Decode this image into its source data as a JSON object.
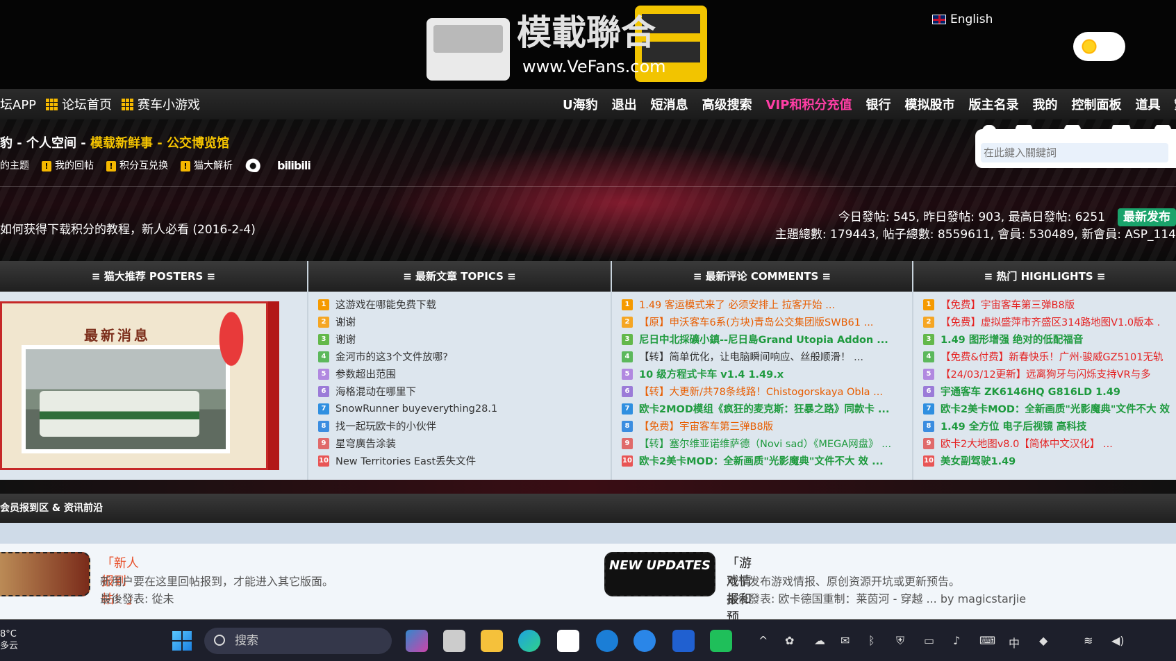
{
  "header": {
    "logo_text": "模載聯合",
    "logo_url": "www.VeFans.com",
    "language": "English"
  },
  "nav": {
    "left": [
      "坛APP",
      "论坛首页",
      "赛车小游戏"
    ],
    "right": [
      "U海豹",
      "退出",
      "短消息",
      "高级搜索",
      "VIP和积分充值",
      "银行",
      "模拟股市",
      "版主名录",
      "我的",
      "控制面板",
      "道具",
      "繁"
    ]
  },
  "banner": {
    "subnav_a": "豹 - 个人空间 - ",
    "subnav_b": "模载新鲜事",
    "subnav_sep": " - ",
    "subnav_c": "公交博览馆",
    "links": [
      "的主题",
      "我的回帖",
      "积分互兑换",
      "猫大解析"
    ],
    "bili": "bilibili",
    "search_placeholder": "在此鍵入關鍵詞",
    "notice": "如何获得下载积分的教程，新人必看 (2016-2-4)",
    "stats_line1": "今日發帖: 545, 昨日發帖: 903, 最高日發帖: 6251",
    "newest_button": "最新发布",
    "stats_line2": "主題總數: 179443, 帖子總數: 8559611, 會員: 530489, 新會員: ASP_114"
  },
  "panels": {
    "posters": {
      "title": "≡ 猫大推荐 POSTERS ≡",
      "poster_title": "最新消息"
    },
    "topics": {
      "title": "≡ 最新文章 TOPICS ≡",
      "items": [
        "这游戏在哪能免费下载",
        "谢谢",
        "谢谢",
        "金河市的这3个文件放哪?",
        "参数超出范围",
        "海格混动在哪里下",
        "SnowRunner buyeverything28.1",
        "找一起玩欧卡的小伙伴",
        "星穹廣告涂装",
        "New Territories East丢失文件"
      ]
    },
    "comments": {
      "title": "≡ 最新评论 COMMENTS ≡",
      "items": [
        "1.49 客运模式来了 必须安排上 拉客开始 ...",
        "【原】申沃客车6系(方块)青岛公交集团版SWB61 ...",
        "尼日中北採礦小鎮--尼日島Grand Utopia Addon ...",
        "【转】简单优化，让电脑瞬间响应、丝般顺滑！ ...",
        "10 级方程式卡车 v1.4 1.49.x",
        "【转】大更新/共78条线路！Chistogorskaya Obla ...",
        "欧卡2MOD模组《疯狂的麦克斯：狂暴之路》同款卡 ...",
        "【免费】宇宙客车第三弹B8版",
        "【转】塞尔维亚诺维萨德（Novi sad）《MEGA网盘》 ...",
        "欧卡2美卡MOD：全新画质\"光影魔典\"文件不大 效 ..."
      ]
    },
    "highlights": {
      "title": "≡ 热门 HIGHLIGHTS ≡",
      "items": [
        "【免费】宇宙客车第三弹B8版",
        "【免费】虚拟盛萍市齐盛区314路地图V1.0版本 .",
        "1.49 图形增强 绝对的低配福音",
        "【免费&付费】新春快乐！广州·骏威GZ5101无轨",
        "【24/03/12更新】远离狗牙与闪烁支持VR与多",
        "宇通客车 ZK6146HQ G816LD 1.49",
        "欧卡2美卡MOD：全新画质\"光影魔典\"文件不大 效",
        "1.49 全方位 电子后视镜 高科技",
        "欧卡2大地图v8.0【简体中文汉化】 ...",
        "美女副驾驶1.49"
      ]
    }
  },
  "section": {
    "title": "会员报到区 & 资讯前沿"
  },
  "forums": [
    {
      "title": "「新人报到帖！」",
      "desc": "新用户要在这里回帖报到，才能进入其它版面。",
      "last": "最後發表: 從未"
    },
    {
      "title": "「游戏情报和预告」",
      "desc": "用于发布游戏情报、原创资源开坑或更新预告。",
      "last": "最後發表: 欧卡德国重制：莱茵河 - 穿越 ... by magicstarjie",
      "badge": "NEW UPDATES"
    }
  ],
  "taskbar": {
    "temp": "8°C",
    "weather": "多云",
    "search": "搜索",
    "ime": "中"
  }
}
